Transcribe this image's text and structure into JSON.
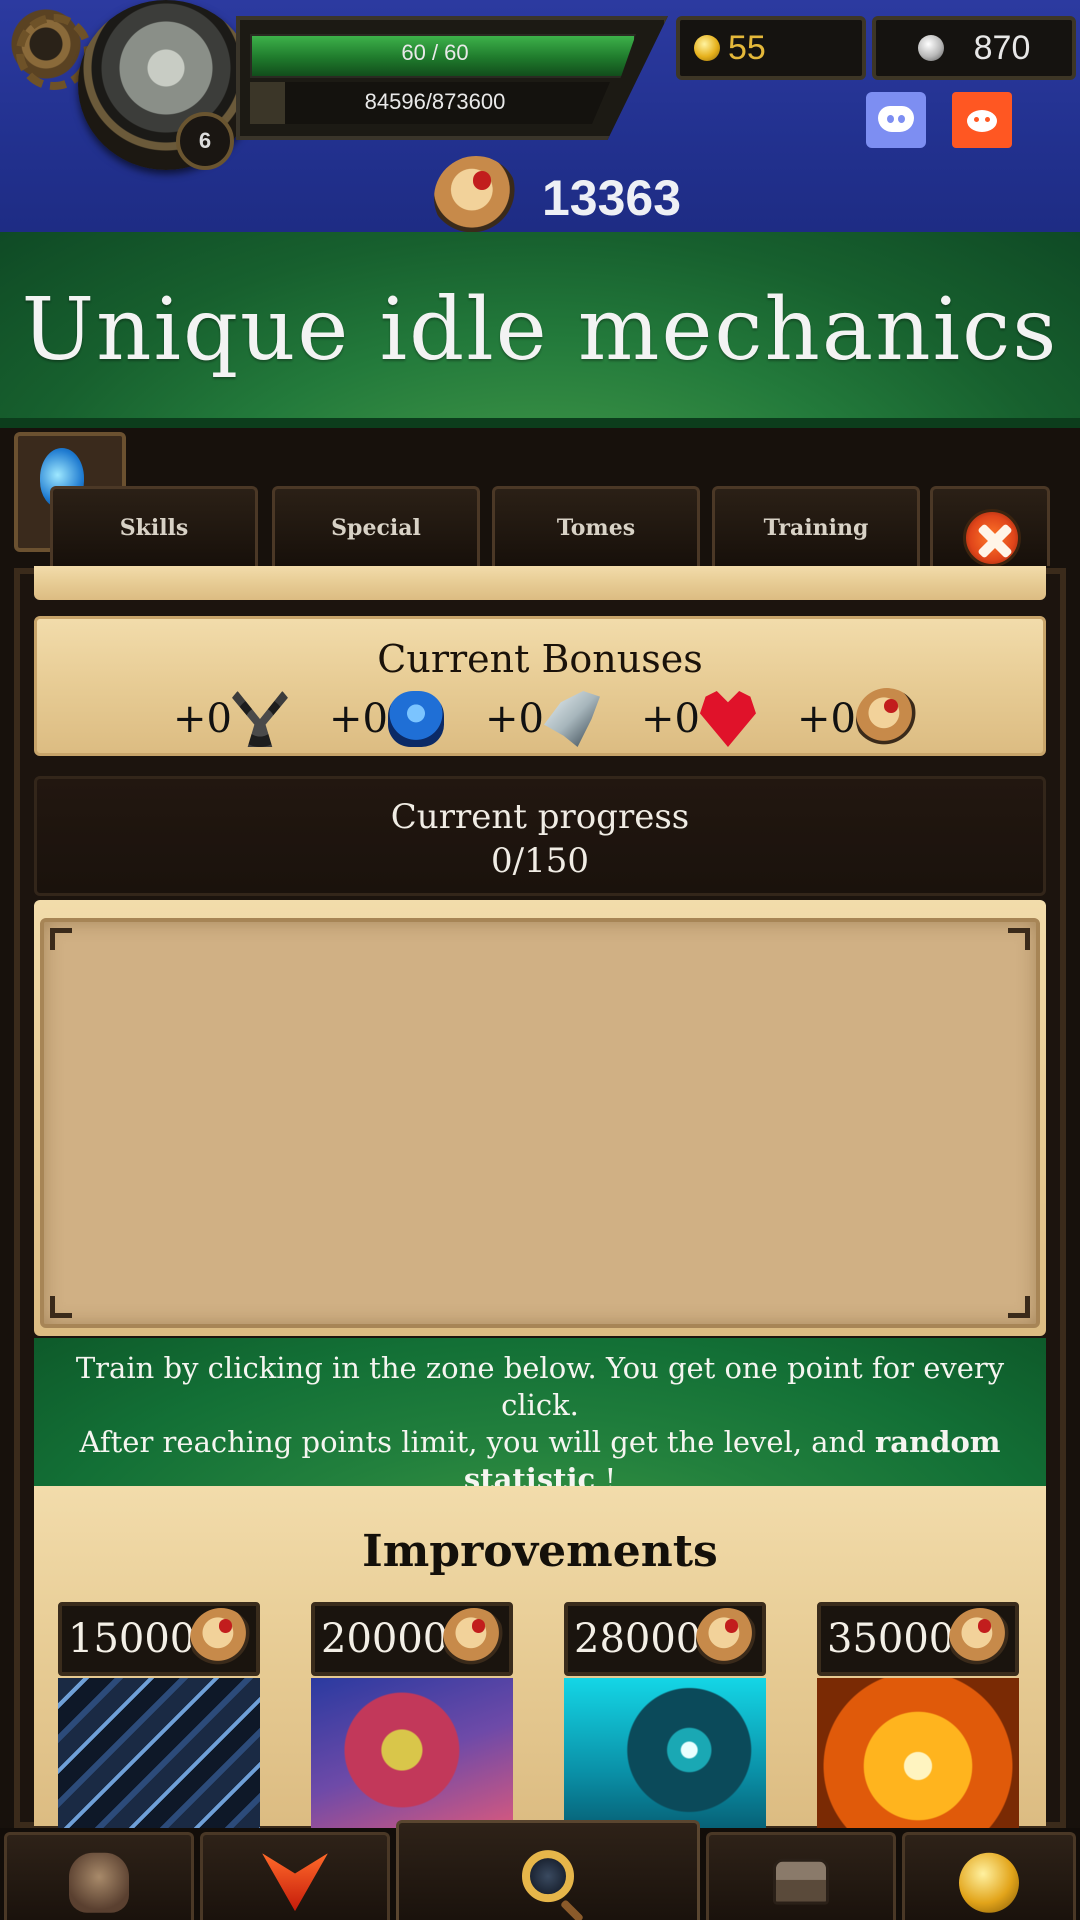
{
  "hud": {
    "level": "6",
    "hp_text": "60 / 60",
    "hp_fraction": 1.0,
    "xp_text": "84596/873600",
    "xp_fraction": 0.097,
    "gold": "55",
    "silver": "870",
    "scrolls": "13363",
    "icons": [
      "gear-icon",
      "portrait",
      "discord-icon",
      "reddit-icon",
      "scroll-icon",
      "gold-coin-icon",
      "silver-coin-icon"
    ]
  },
  "banner": {
    "title": "Unique idle mechanics"
  },
  "tabs": [
    {
      "label": "Skills"
    },
    {
      "label": "Special"
    },
    {
      "label": "Tomes"
    },
    {
      "label": "Training"
    }
  ],
  "bonuses": {
    "title": "Current Bonuses",
    "items": [
      {
        "value": "+0",
        "icon": "sword-icon"
      },
      {
        "value": "+0",
        "icon": "armor-icon"
      },
      {
        "value": "+0",
        "icon": "wing-icon"
      },
      {
        "value": "+0",
        "icon": "heart-icon"
      },
      {
        "value": "+0",
        "icon": "scroll-icon"
      }
    ]
  },
  "progress": {
    "title": "Current progress",
    "value": "0/150"
  },
  "info": {
    "line1": "Train by clicking in the zone below. You get one point for every click.",
    "line2_prefix": "After reaching points limit, you will get the level, and",
    "bold_1": "random",
    "bold_2": "statistic",
    "suffix": "!"
  },
  "improvements": {
    "title": "Improvements",
    "items": [
      {
        "price": "15000"
      },
      {
        "price": "20000"
      },
      {
        "price": "28000"
      },
      {
        "price": "35000"
      }
    ]
  },
  "nav": [
    "fist-icon",
    "hero-icon",
    "magnifier-icon",
    "chest-icon",
    "coins-icon"
  ],
  "colors": {
    "banner_green": "#237a3b",
    "hud_blue": "#2c3aa0",
    "wood": "#e8cd96",
    "gold": "#e4b83a"
  }
}
